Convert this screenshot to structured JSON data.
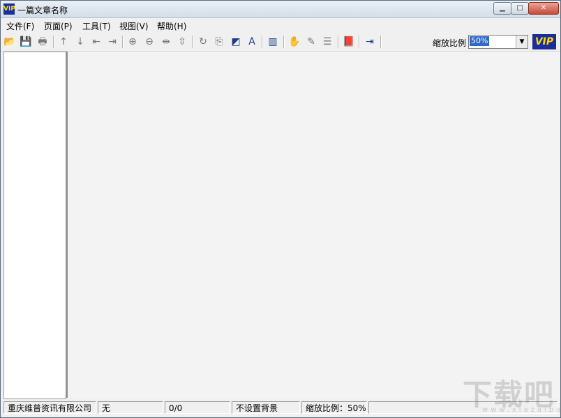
{
  "window": {
    "title": "一篇文章名称",
    "app_icon_text": "VIP",
    "buttons": {
      "minimize": "▁",
      "maximize": "□",
      "close": "✕"
    }
  },
  "menubar": {
    "items": [
      {
        "label": "文件(F)"
      },
      {
        "label": "页面(P)"
      },
      {
        "label": "工具(T)"
      },
      {
        "label": "视图(V)"
      },
      {
        "label": "帮助(H)"
      }
    ]
  },
  "toolbar": {
    "icons": [
      "open-folder-icon",
      "save-icon",
      "print-icon",
      "arrow-up-icon",
      "arrow-down-icon",
      "prev-page-icon",
      "next-page-icon",
      "zoom-in-icon",
      "zoom-out-icon",
      "fit-width-icon",
      "fit-height-icon",
      "rotate-icon",
      "copy-icon",
      "color-icon",
      "text-icon",
      "books-icon",
      "hand-icon",
      "note-icon",
      "list-icon",
      "book-icon",
      "exit-icon"
    ],
    "zoom_label": "缩放比例",
    "zoom_value": "50%",
    "logo_text": "VIP"
  },
  "statusbar": {
    "company": "重庆维普资讯有限公司",
    "field2": "无",
    "page_count": "0/0",
    "background": "不设置背景",
    "zoom": "缩放比例：50%"
  },
  "watermark": {
    "text": "下载吧",
    "sub": "www.xiazaiba.com"
  },
  "colors": {
    "logo_bg": "#1a2d9a",
    "logo_fg": "#ffd800",
    "selection": "#316ac5"
  }
}
